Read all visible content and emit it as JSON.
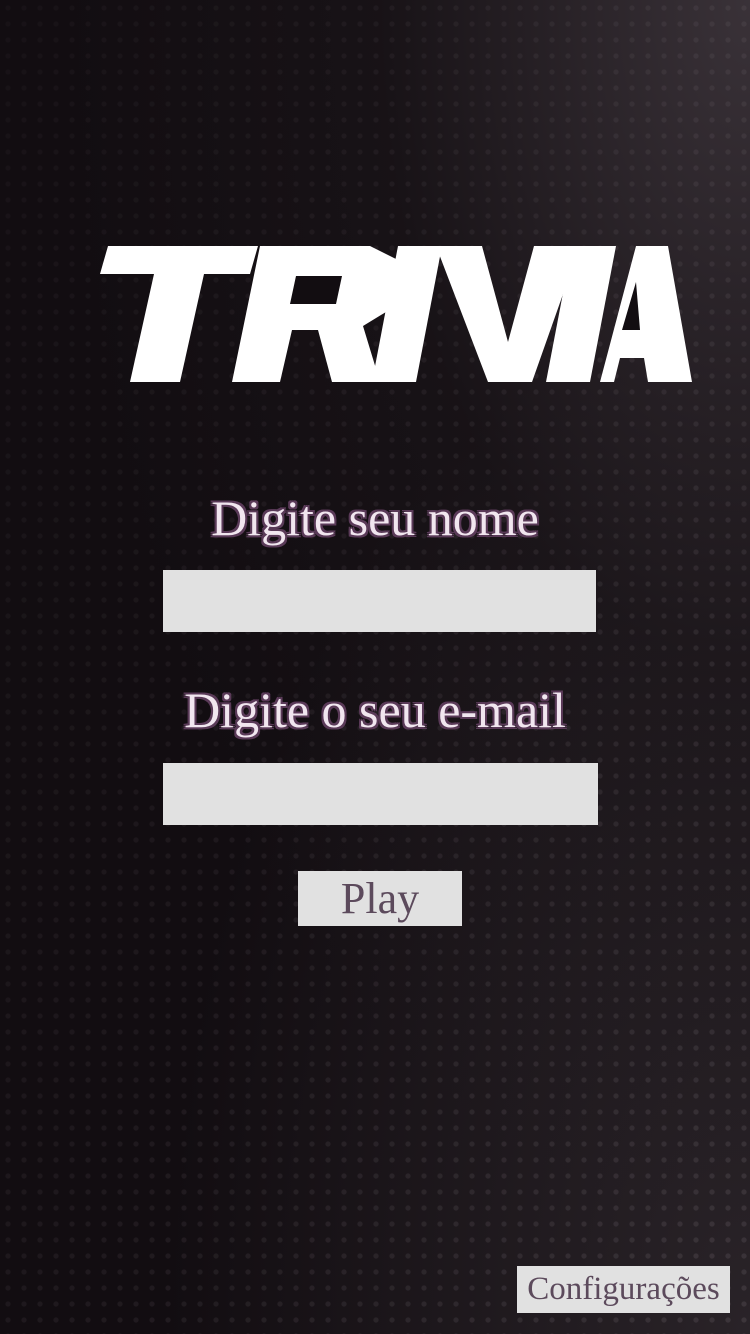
{
  "logo": {
    "text": "TRIVIA"
  },
  "form": {
    "name_label": "Digite seu nome",
    "name_value": "",
    "email_label": "Digite o seu e-mail",
    "email_value": "",
    "play_label": "Play"
  },
  "footer": {
    "settings_label": "Configurações"
  },
  "colors": {
    "background": "#120d11",
    "label_text": "#f1e6ef",
    "label_outline": "#5a3a58",
    "field_bg": "#e1e1e1",
    "button_text": "#5c4a5c"
  }
}
